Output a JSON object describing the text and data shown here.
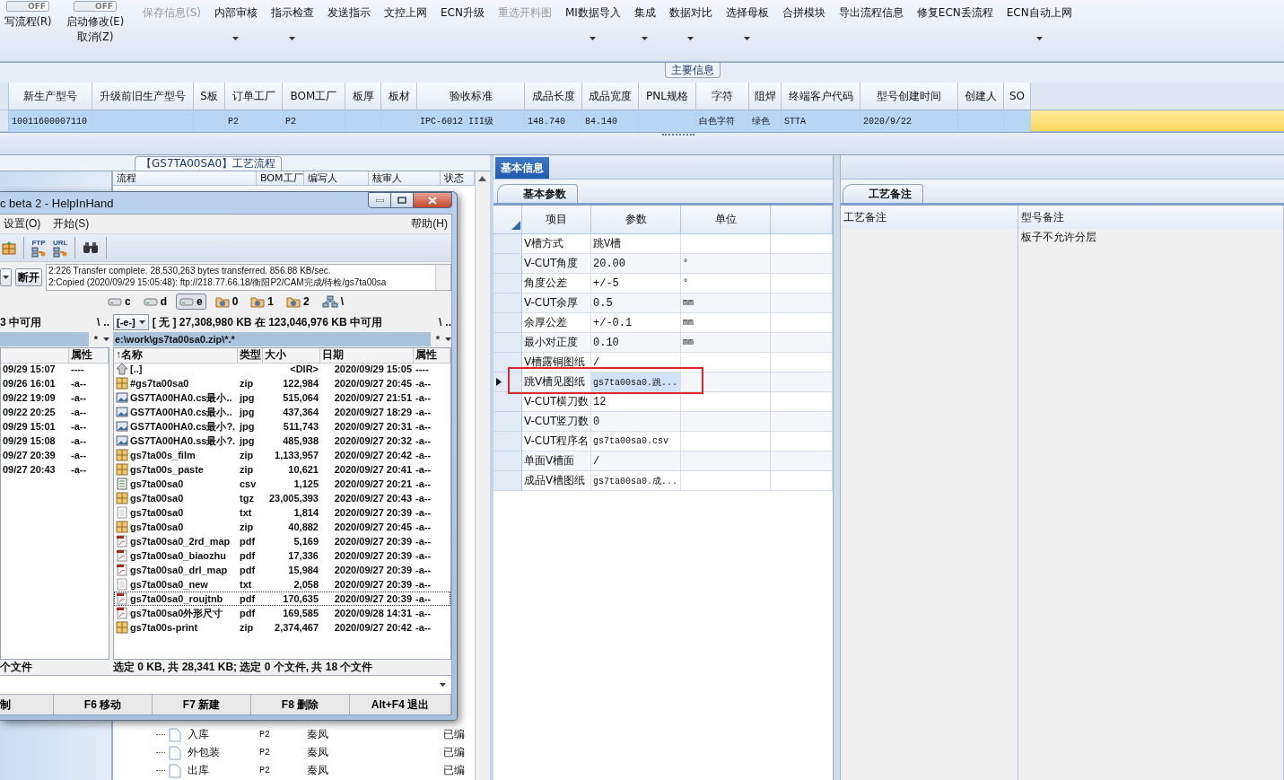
{
  "ribbon": {
    "toggles": [
      {
        "state": "OFF",
        "on": false,
        "label": "写流程(R)"
      },
      {
        "state": "OFF",
        "on": false,
        "label": "启动修改(E)",
        "sub": "取消(Z)"
      }
    ],
    "commands": [
      {
        "label": "保存信息(S)",
        "disabled": true,
        "dropdown": false
      },
      {
        "label": "内部审核",
        "disabled": false,
        "dropdown": true
      },
      {
        "label": "指示检查",
        "disabled": false,
        "dropdown": true
      },
      {
        "label": "发送指示",
        "disabled": false,
        "dropdown": false
      },
      {
        "label": "文控上网",
        "disabled": false,
        "dropdown": false
      },
      {
        "label": "ECN升级",
        "disabled": false,
        "dropdown": false
      },
      {
        "label": "重选开料图",
        "disabled": true,
        "dropdown": false
      },
      {
        "label": "MI数据导入",
        "disabled": false,
        "dropdown": true
      },
      {
        "label": "集成",
        "disabled": false,
        "dropdown": true
      },
      {
        "label": "数据对比",
        "disabled": false,
        "dropdown": true
      },
      {
        "label": "选择母板",
        "disabled": false,
        "dropdown": true
      },
      {
        "label": "合拼模块",
        "disabled": false,
        "dropdown": false
      },
      {
        "label": "导出流程信息",
        "disabled": false,
        "dropdown": false
      },
      {
        "label": "修复ECN丢流程",
        "disabled": false,
        "dropdown": false
      },
      {
        "label": "ECN自动上网",
        "disabled": false,
        "dropdown": true
      }
    ]
  },
  "main_group": {
    "title": "主要信息",
    "columns": [
      "新生产型号",
      "升级前旧生产型号",
      "S板",
      "订单工厂",
      "BOM工厂",
      "板厚",
      "板材",
      "验收标准",
      "成品长度",
      "成品宽度",
      "PNL规格",
      "字符",
      "阻焊",
      "终端客户代码",
      "型号创建时间",
      "创建人",
      "SO"
    ],
    "rows": [
      {
        "selected": true,
        "cells": [
          "10011600007110",
          null,
          null,
          "P2",
          "P2",
          null,
          null,
          "IPC-6012 III级",
          "148.740",
          "84.140",
          null,
          "白色字符",
          "绿色",
          "STTA",
          "2020/9/22",
          null,
          null
        ]
      }
    ]
  },
  "flow_panel": {
    "title": "【GS7TA00SA0】工艺流程",
    "columns": [
      "流程",
      "BOM工厂",
      "编写人",
      "核审人",
      "状态"
    ],
    "rows": [
      {
        "name": "入库",
        "factory": "P2",
        "writer": "秦凤",
        "status": "已编"
      },
      {
        "name": "外包装",
        "factory": "P2",
        "writer": "秦凤",
        "status": "已编"
      },
      {
        "name": "出库",
        "factory": "P2",
        "writer": "秦凤",
        "status": "已编"
      }
    ]
  },
  "ftp_window": {
    "title": "c beta 2 - HelpInHand",
    "menu_left": [
      "设置(O)",
      "开始(S)"
    ],
    "menu_right": "帮助(H)",
    "toolbar": [
      {
        "kind": "package"
      },
      {
        "kind": "ftp",
        "text": "FTP"
      },
      {
        "kind": "url",
        "text": "URL"
      },
      {
        "kind": "find"
      }
    ],
    "disconnect": "断开",
    "log": [
      "2:226 Transfer complete. 28,530,263 bytes transferred. 856.88 KB/sec.",
      "2:Copied (2020/09/29 15:05:48): ftp://218.77.66.18/衡阳P2/CAM完成/待检/gs7ta00sa"
    ],
    "drives": [
      {
        "kind": "drive",
        "label": "c",
        "selected": false
      },
      {
        "kind": "drive",
        "label": "d",
        "selected": false
      },
      {
        "kind": "drive",
        "label": "e",
        "selected": true
      },
      {
        "kind": "folder",
        "label": "0",
        "selected": false
      },
      {
        "kind": "folder",
        "label": "1",
        "selected": false
      },
      {
        "kind": "folder",
        "label": "2",
        "selected": false
      },
      {
        "kind": "network",
        "label": "\\",
        "selected": false
      }
    ],
    "left_pane": {
      "free": "3 中可用",
      "root": "\\",
      "up": "..",
      "filter": "*",
      "attr_header": "属性",
      "rows": [
        {
          "date": "09/29 15:07",
          "attr": "----"
        },
        {
          "date": "09/26 16:01",
          "attr": "-a--"
        },
        {
          "date": "09/22 19:09",
          "attr": "-a--"
        },
        {
          "date": "09/22 20:25",
          "attr": "-a--"
        },
        {
          "date": "09/29 15:01",
          "attr": "-a--"
        },
        {
          "date": "09/29 15:08",
          "attr": "-a--"
        },
        {
          "date": "09/27 20:39",
          "attr": "-a--"
        },
        {
          "date": "09/27 20:43",
          "attr": "-a--"
        }
      ],
      "status": "个文件"
    },
    "right_pane": {
      "drive": "[-e-]",
      "free": "[ 无 ]  27,308,980 KB 在 123,046,976 KB 中可用",
      "root": "\\",
      "up": "..",
      "path": "e:\\work\\gs7ta00sa0.zip\\*.*",
      "filter": "*",
      "columns": [
        "↑名称",
        "类型",
        "大小",
        "日期",
        "属性"
      ],
      "files": [
        {
          "kind": "up",
          "name": "[..]",
          "size": "<DIR>",
          "date": "2020/09/29 15:05",
          "attr": "----",
          "focused": false
        },
        {
          "kind": "zip",
          "name": "#gs7ta00sa0",
          "type": "zip",
          "size": "122,984",
          "date": "2020/09/27 20:45",
          "attr": "-a--",
          "focused": false
        },
        {
          "kind": "image",
          "name": "GS7TA00HA0.cs最小..",
          "type": "jpg",
          "size": "515,064",
          "date": "2020/09/27 21:51",
          "attr": "-a--",
          "focused": false
        },
        {
          "kind": "image",
          "name": "GS7TA00HA0.cs最小..",
          "type": "jpg",
          "size": "437,364",
          "date": "2020/09/27 18:29",
          "attr": "-a--",
          "focused": false
        },
        {
          "kind": "image",
          "name": "GS7TA00HA0.cs最小?.",
          "type": "jpg",
          "size": "511,743",
          "date": "2020/09/27 20:31",
          "attr": "-a--",
          "focused": false
        },
        {
          "kind": "image",
          "name": "GS7TA00HA0.ss最小?.",
          "type": "jpg",
          "size": "485,938",
          "date": "2020/09/27 20:32",
          "attr": "-a--",
          "focused": false
        },
        {
          "kind": "zip",
          "name": "gs7ta00s_film",
          "type": "zip",
          "size": "1,133,957",
          "date": "2020/09/27 20:42",
          "attr": "-a--",
          "focused": false
        },
        {
          "kind": "zip",
          "name": "gs7ta00s_paste",
          "type": "zip",
          "size": "10,621",
          "date": "2020/09/27 20:41",
          "attr": "-a--",
          "focused": false
        },
        {
          "kind": "csv",
          "name": "gs7ta00sa0",
          "type": "csv",
          "size": "1,125",
          "date": "2020/09/27 20:21",
          "attr": "-a--",
          "focused": false
        },
        {
          "kind": "zip",
          "name": "gs7ta00sa0",
          "type": "tgz",
          "size": "23,005,393",
          "date": "2020/09/27 20:43",
          "attr": "-a--",
          "focused": false
        },
        {
          "kind": "txt",
          "name": "gs7ta00sa0",
          "type": "txt",
          "size": "1,814",
          "date": "2020/09/27 20:39",
          "attr": "-a--",
          "focused": false
        },
        {
          "kind": "zip",
          "name": "gs7ta00sa0",
          "type": "zip",
          "size": "40,882",
          "date": "2020/09/27 20:45",
          "attr": "-a--",
          "focused": false
        },
        {
          "kind": "pdf",
          "name": "gs7ta00sa0_2rd_map",
          "type": "pdf",
          "size": "5,169",
          "date": "2020/09/27 20:39",
          "attr": "-a--",
          "focused": false
        },
        {
          "kind": "pdf",
          "name": "gs7ta00sa0_biaozhu",
          "type": "pdf",
          "size": "17,336",
          "date": "2020/09/27 20:39",
          "attr": "-a--",
          "focused": false
        },
        {
          "kind": "pdf",
          "name": "gs7ta00sa0_drl_map",
          "type": "pdf",
          "size": "15,984",
          "date": "2020/09/27 20:39",
          "attr": "-a--",
          "focused": false
        },
        {
          "kind": "txt",
          "name": "gs7ta00sa0_new",
          "type": "txt",
          "size": "2,058",
          "date": "2020/09/27 20:39",
          "attr": "-a--",
          "focused": false
        },
        {
          "kind": "pdf",
          "name": "gs7ta00sa0_roujtnb",
          "type": "pdf",
          "size": "170,635",
          "date": "2020/09/27 20:39",
          "attr": "-a--",
          "focused": true
        },
        {
          "kind": "pdf",
          "name": "gs7ta00sa0外形尺寸",
          "type": "pdf",
          "size": "169,585",
          "date": "2020/09/28 14:31",
          "attr": "-a--",
          "focused": false
        },
        {
          "kind": "zip",
          "name": "gs7ta00s-print",
          "type": "zip",
          "size": "2,374,467",
          "date": "2020/09/27 20:42",
          "attr": "-a--",
          "focused": false
        }
      ],
      "status": "选定 0 KB, 共 28,341 KB; 选定 0 个文件, 共 18 个文件"
    },
    "function_keys": [
      "制",
      "F6 移动",
      "F7 新建",
      "F8 删除",
      "Alt+F4 退出"
    ]
  },
  "params_panel": {
    "tab": "基本信息",
    "subtab": "基本参数",
    "columns": [
      "项目",
      "参数",
      "单位"
    ],
    "rows": [
      {
        "item": "V槽方式",
        "value": "跳V槽",
        "selected": false,
        "highlighted": false
      },
      {
        "item": "V-CUT角度",
        "value": "20.00",
        "unit": "°",
        "selected": false,
        "highlighted": false
      },
      {
        "item": "角度公差",
        "value": "+/-5",
        "unit": "°",
        "selected": false,
        "highlighted": false
      },
      {
        "item": "V-CUT余厚",
        "value": "0.5",
        "unit": "mm",
        "selected": false,
        "highlighted": false
      },
      {
        "item": "余厚公差",
        "value": "+/-0.1",
        "unit": "mm",
        "selected": false,
        "highlighted": false
      },
      {
        "item": "最小对正度",
        "value": "0.10",
        "unit": "mm",
        "selected": false,
        "highlighted": false
      },
      {
        "item": "V槽露铜图纸",
        "value": "/",
        "selected": false,
        "highlighted": false
      },
      {
        "item": "跳V槽见图纸",
        "value": "gs7ta00sa0.跳...",
        "selected": true,
        "highlighted": true
      },
      {
        "item": "V-CUT横刀数",
        "value": "12",
        "selected": false,
        "highlighted": false
      },
      {
        "item": "V-CUT竖刀数",
        "value": "0",
        "selected": false,
        "highlighted": false
      },
      {
        "item": "V-CUT程序名",
        "value": "gs7ta00sa0.csv",
        "selected": false,
        "highlighted": false
      },
      {
        "item": "单面V槽面",
        "value": "/",
        "selected": false,
        "highlighted": false
      },
      {
        "item": "成品V槽图纸",
        "value": "gs7ta00sa0.成...",
        "selected": false,
        "highlighted": false
      }
    ]
  },
  "notes_panel": {
    "subtab": "工艺备注",
    "columns": [
      "工艺备注",
      "型号备注"
    ],
    "model_note": "板子不允许分层"
  }
}
